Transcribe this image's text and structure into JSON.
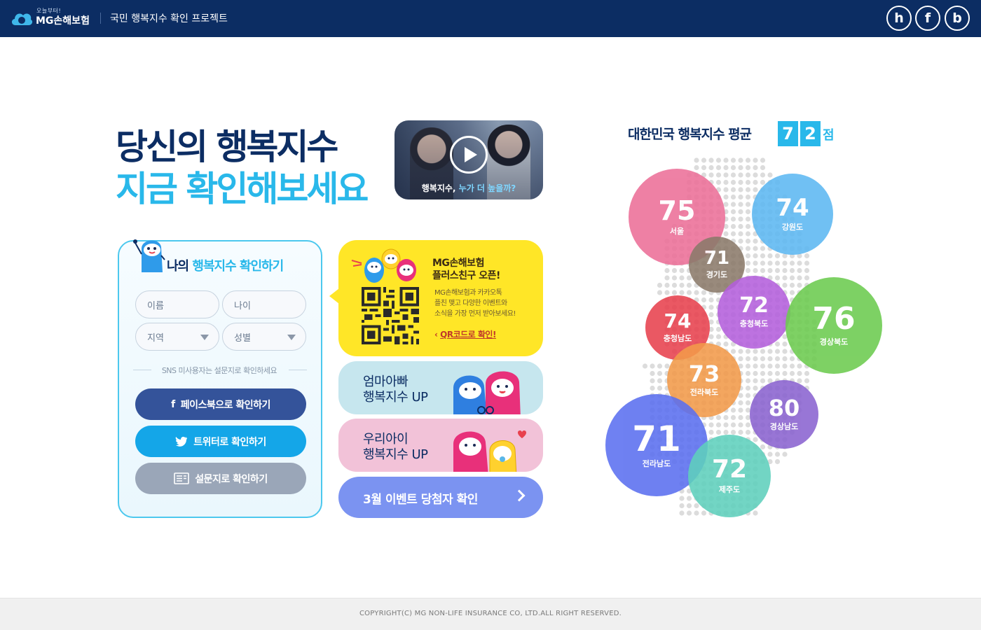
{
  "header": {
    "logo_small": "오늘부터!",
    "logo_main": "MG손해보험",
    "project_title": "국민 행복지수 확인 프로젝트",
    "sns": [
      {
        "label": "h",
        "icon": "blog-icon"
      },
      {
        "label": "f",
        "icon": "facebook-icon"
      },
      {
        "label": "b",
        "icon": "band-icon"
      }
    ]
  },
  "headline": {
    "line1": "당신의 행복지수",
    "line2": "지금 확인해보세요"
  },
  "video": {
    "caption_prefix": "행복지수, ",
    "caption_highlight": "누가 더 높을까?"
  },
  "check_panel": {
    "title_prefix": "나의 ",
    "title_highlight": "행복지수 확인하기",
    "fields": {
      "name": "이름",
      "age": "나이",
      "region": "지역",
      "gender": "성별"
    },
    "separator": "SNS 미사용자는 설문지로 확인하세요",
    "buttons": {
      "facebook": "페이스북으로 확인하기",
      "twitter": "트위터로 확인하기",
      "survey": "설문지로 확인하기"
    }
  },
  "kakao": {
    "title_line1": "MG손해보험",
    "title_line2": "플러스친구 오픈!",
    "desc_line1": "MG손해보험과 카카오톡",
    "desc_line2": "플친 맺고 다양한 이벤트와",
    "desc_line3": "소식을 가장 먼저 받아보세요!",
    "link": "QR코드로 확인!"
  },
  "banners": {
    "parents_line1": "엄마아빠",
    "parents_line2": "행복지수 UP",
    "child_line1": "우리아이",
    "child_line2": "행복지수 UP",
    "event": "3월 이벤트 당첨자 확인"
  },
  "map": {
    "title": "대한민국 행복지수 평균",
    "score_digit1": "7",
    "score_digit2": "2",
    "score_unit": "점",
    "regions": [
      {
        "name": "서울",
        "value": "75",
        "color": "#ec6f98"
      },
      {
        "name": "강원도",
        "value": "74",
        "color": "#5db8f2"
      },
      {
        "name": "경기도",
        "value": "71",
        "color": "#8b7a6a"
      },
      {
        "name": "충청북도",
        "value": "72",
        "color": "#b45fdc"
      },
      {
        "name": "경상북도",
        "value": "76",
        "color": "#6ccb4f"
      },
      {
        "name": "충청남도",
        "value": "74",
        "color": "#e8414e"
      },
      {
        "name": "전라북도",
        "value": "73",
        "color": "#f29a4a"
      },
      {
        "name": "경상남도",
        "value": "80",
        "color": "#8a63d0"
      },
      {
        "name": "전라남도",
        "value": "71",
        "color": "#5b6ff0"
      },
      {
        "name": "제주도",
        "value": "72",
        "color": "#5fd0bd"
      }
    ]
  },
  "footer": {
    "copyright": "COPYRIGHT(C) MG NON-LIFE INSURANCE CO, LTD.ALL RIGHT RESERVED."
  }
}
